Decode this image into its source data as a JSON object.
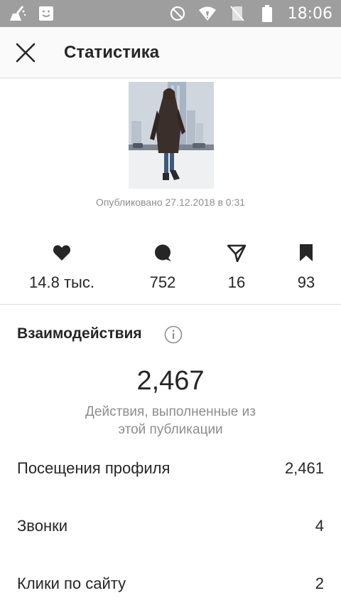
{
  "status_bar": {
    "time": "18:06",
    "icons": [
      "cleaner-icon",
      "face-screen-icon",
      "do-not-disturb-icon",
      "wifi-icon",
      "no-sim-icon",
      "battery-icon"
    ]
  },
  "header": {
    "title": "Статистика",
    "close_icon": "close-icon"
  },
  "post": {
    "published": "Опубликовано 27.12.2018 в 0:31"
  },
  "stats": [
    {
      "icon": "heart-icon",
      "value": "14.8 тыс."
    },
    {
      "icon": "comment-icon",
      "value": "752"
    },
    {
      "icon": "share-icon",
      "value": "16"
    },
    {
      "icon": "bookmark-icon",
      "value": "93"
    }
  ],
  "interactions": {
    "title": "Взаимодействия",
    "total": "2,467",
    "caption": "Действия, выполненные из этой публикации",
    "rows": [
      {
        "label": "Посещения профиля",
        "value": "2,461"
      },
      {
        "label": "Звонки",
        "value": "4"
      },
      {
        "label": "Клики по сайту",
        "value": "2"
      }
    ]
  },
  "colors": {
    "status_bar": "#9e9e9e",
    "text": "#262626",
    "secondary": "#8e8e8e",
    "divider": "#dbdbdb"
  }
}
